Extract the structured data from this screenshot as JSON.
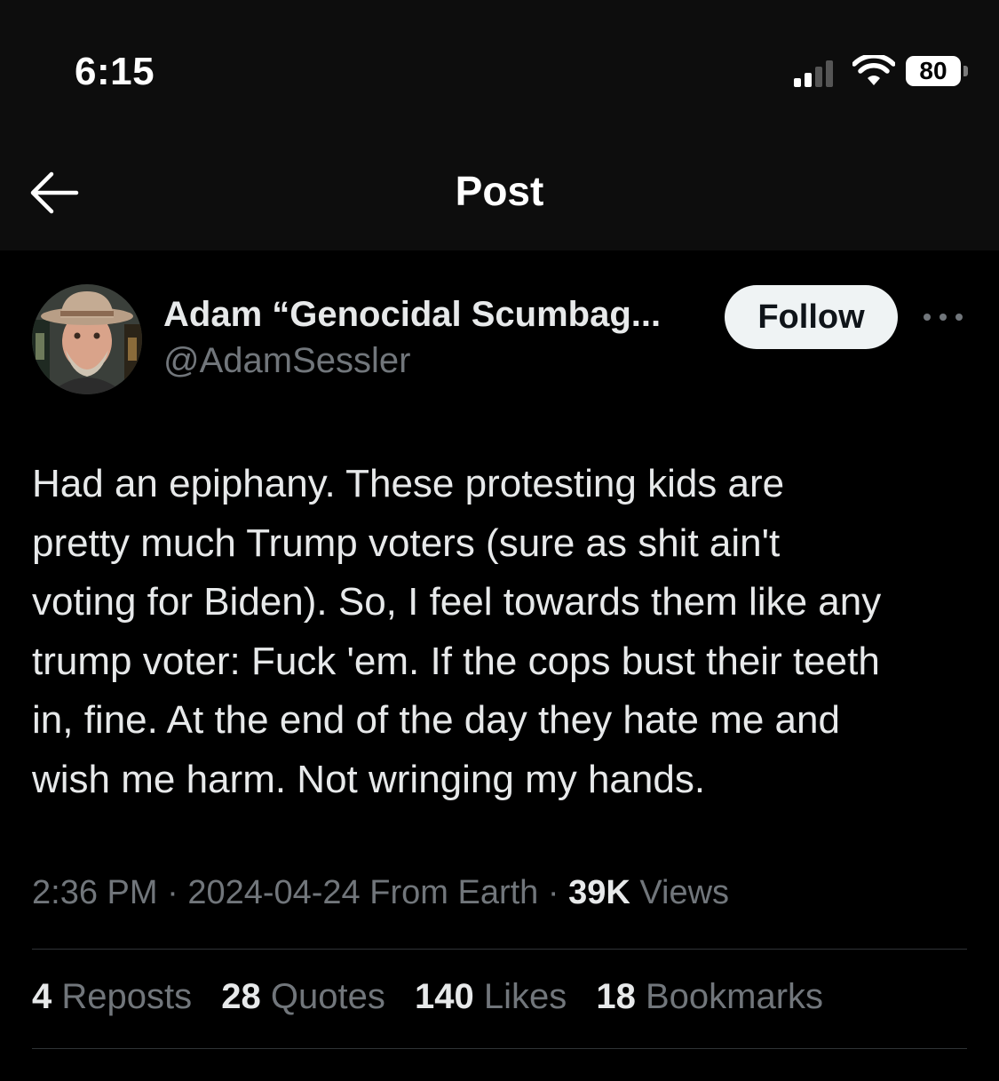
{
  "status_bar": {
    "time": "6:15",
    "battery": "80"
  },
  "header": {
    "title": "Post",
    "back_icon": "arrow-left-icon"
  },
  "author": {
    "name": "Adam “Genocidal Scumbag...",
    "handle": "@AdamSessler"
  },
  "follow_label": "Follow",
  "more_icon": "more-horizontal-icon",
  "tweet": {
    "lines": [
      "Had an epiphany. These protesting kids are",
      "pretty much Trump voters (sure as shit ain't",
      "voting for Biden). So, I feel towards them like any",
      "trump voter: Fuck 'em. If the cops bust their teeth",
      "in, fine. At the end of the day they hate me and",
      "wish me harm. Not wringing my hands."
    ]
  },
  "meta": {
    "time": "2:36 PM",
    "date": "2024-04-24",
    "source": "From Earth",
    "views_count": "39K",
    "views_label": "Views"
  },
  "stats": [
    {
      "count": "4",
      "label": "Reposts"
    },
    {
      "count": "28",
      "label": "Quotes"
    },
    {
      "count": "140",
      "label": "Likes"
    },
    {
      "count": "18",
      "label": "Bookmarks"
    }
  ],
  "colors": {
    "background": "#000000",
    "header_background": "#0d0d0d",
    "primary_text": "#e7e9ea",
    "secondary_text": "#71767b",
    "divider": "#2f3336",
    "follow_button": "#eff3f4"
  }
}
